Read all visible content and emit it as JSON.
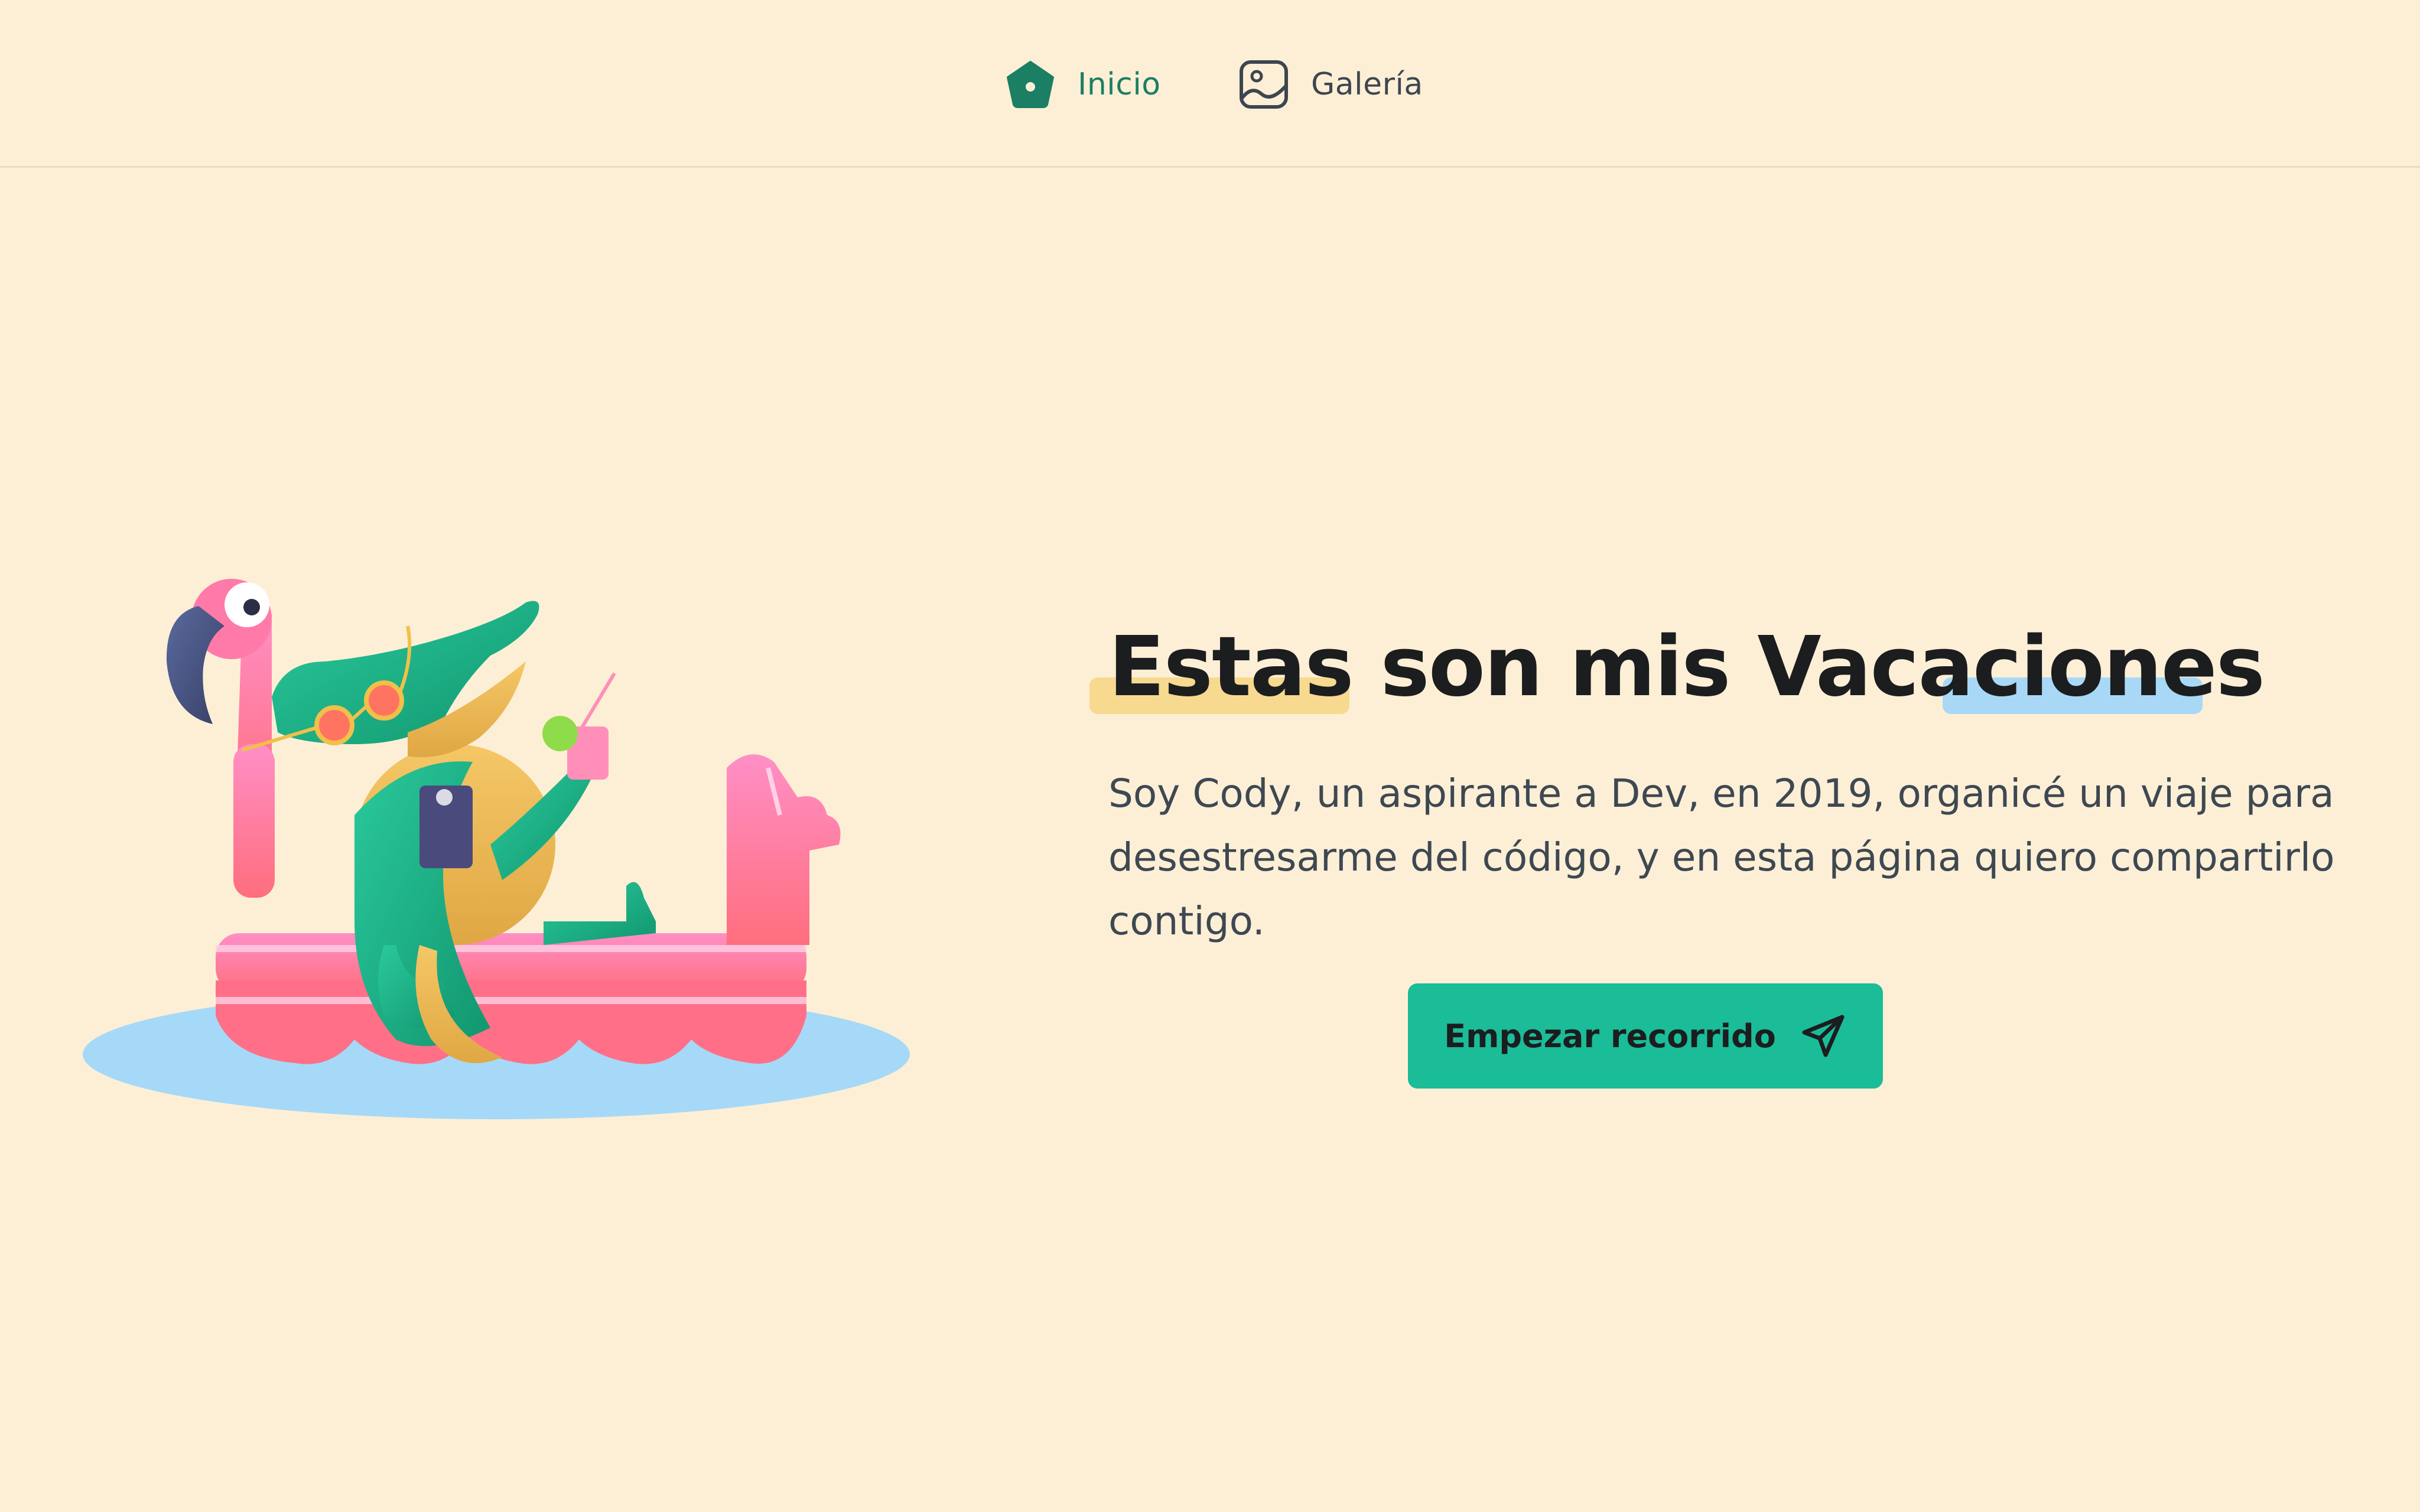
{
  "nav": {
    "home": {
      "label": "Inicio",
      "icon": "home-icon"
    },
    "gallery": {
      "label": "Galería",
      "icon": "image-icon"
    }
  },
  "hero": {
    "title": "Estas son mis Vacaciones",
    "description": "Soy Cody, un aspirante a Dev, en 2019, organicé un viaje para desestresarme del código, y en esta página quiero compartirlo contigo.",
    "cta_label": "Empezar recorrido",
    "cta_icon": "paper-plane-icon"
  },
  "colors": {
    "background": "#fdefd6",
    "accent": "#1bbc98",
    "accent_dark": "#1a7f63",
    "highlight_yellow": "#f7d98f",
    "highlight_blue": "#a9d8f7"
  },
  "illustration": {
    "subject": "crocodile-on-flamingo-float-illustration"
  }
}
